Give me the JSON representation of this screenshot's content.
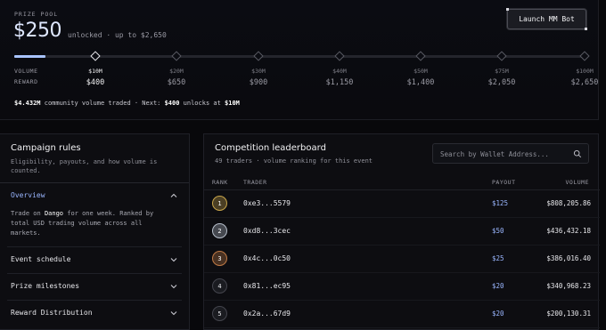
{
  "prize": {
    "label": "PRIZE POOL",
    "amount": "$250",
    "subtitle": "unlocked · up to $2,650",
    "progress_fraction": 0.055
  },
  "launch_button": {
    "label": "Launch MM Bot"
  },
  "milestones": {
    "volume_label": "VOLUME",
    "reward_label": "REWARD",
    "items": [
      {
        "volume": "$10M",
        "reward": "$400",
        "active": true
      },
      {
        "volume": "$20M",
        "reward": "$650",
        "active": false
      },
      {
        "volume": "$30M",
        "reward": "$900",
        "active": false
      },
      {
        "volume": "$40M",
        "reward": "$1,150",
        "active": false
      },
      {
        "volume": "$50M",
        "reward": "$1,400",
        "active": false
      },
      {
        "volume": "$75M",
        "reward": "$2,050",
        "active": false
      },
      {
        "volume": "$100M",
        "reward": "$2,650",
        "active": false
      }
    ]
  },
  "progress_note": {
    "traded": "$4.432M",
    "text_mid": " community volume traded · Next: ",
    "next_reward": "$400",
    "text_end": " unlocks at ",
    "next_volume": "$10M"
  },
  "rules": {
    "title": "Campaign rules",
    "description": "Eligibility, payouts, and how volume is counted.",
    "sections": [
      {
        "label": "Overview",
        "expanded": true,
        "body_pre": "Trade on ",
        "body_bold": "Dango",
        "body_post": " for one week. Ranked by total USD trading volume across all markets."
      },
      {
        "label": "Event schedule",
        "expanded": false
      },
      {
        "label": "Prize milestones",
        "expanded": false
      },
      {
        "label": "Reward Distribution",
        "expanded": false
      }
    ]
  },
  "leaderboard": {
    "title": "Competition leaderboard",
    "subtitle": "49 traders · volume ranking for this event",
    "search_placeholder": "Search by Wallet Address...",
    "columns": {
      "rank": "RANK",
      "trader": "TRADER",
      "payout": "PAYOUT",
      "volume": "VOLUME"
    },
    "rows": [
      {
        "rank": "1",
        "trader": "0xe3...5579",
        "payout": "$125",
        "volume": "$808,205.86",
        "medal": "#c9a64a"
      },
      {
        "rank": "2",
        "trader": "0xd8...3cec",
        "payout": "$50",
        "volume": "$436,432.18",
        "medal": "#b8c0cc"
      },
      {
        "rank": "3",
        "trader": "0x4c...0c50",
        "payout": "$25",
        "volume": "$386,016.40",
        "medal": "#c07a45"
      },
      {
        "rank": "4",
        "trader": "0x81...ec95",
        "payout": "$20",
        "volume": "$340,968.23",
        "medal": "#44454d"
      },
      {
        "rank": "5",
        "trader": "0x2a...67d9",
        "payout": "$20",
        "volume": "$200,130.31",
        "medal": "#44454d"
      }
    ]
  },
  "colors": {
    "accent": "#9ab6ff",
    "background": "#08080b",
    "panel": "#0d0d11",
    "border": "#1f2027"
  }
}
